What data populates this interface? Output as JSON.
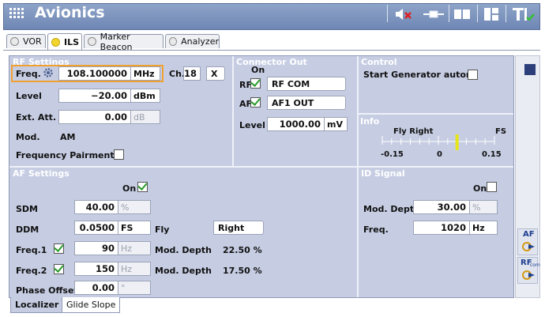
{
  "app": {
    "title": "Avionics"
  },
  "tabs": [
    {
      "label": "VOR",
      "active": false
    },
    {
      "label": "ILS",
      "active": true
    },
    {
      "label": "Marker Beacon",
      "active": false
    },
    {
      "label": "Analyzer",
      "active": false
    }
  ],
  "rf": {
    "title": "RF Settings",
    "freq_label": "Freq.",
    "freq_value": "108.100000",
    "freq_unit": "MHz",
    "ch_label": "Ch.",
    "ch_value": "18",
    "ch_suffix": "X",
    "level_label": "Level",
    "level_value": "−20.00",
    "level_unit": "dBm",
    "ext_label": "Ext. Att.",
    "ext_value": "0.00",
    "ext_unit": "dB",
    "mod_label": "Mod.",
    "mod_value": "AM",
    "pair_label": "Frequency Pairment",
    "pair_checked": false
  },
  "connector": {
    "title": "Connector Out",
    "on_label": "On",
    "rf_label": "RF",
    "rf_checked": true,
    "rf_value": "RF COM",
    "af_label": "AF",
    "af_checked": true,
    "af_value": "AF1 OUT",
    "level_label": "Level",
    "level_value": "1000.00",
    "level_unit": "mV"
  },
  "control": {
    "title": "Control",
    "start_label": "Start Generator autom.",
    "start_checked": false
  },
  "info": {
    "title": "Info",
    "fly_label": "Fly Right",
    "fs_label": "FS",
    "ticks": [
      "-0.15",
      "0",
      "0.15"
    ],
    "indicator_value": 0.05,
    "indicator_color": "#e5e51a"
  },
  "af": {
    "title": "AF Settings",
    "on_label": "On",
    "on_checked": true,
    "sdm_label": "SDM",
    "sdm_value": "40.00",
    "sdm_unit": "%",
    "ddm_label": "DDM",
    "ddm_value": "0.0500",
    "ddm_unit": "FS",
    "fly_label": "Fly",
    "fly_value": "Right",
    "freq1_label": "Freq.1",
    "freq1_checked": true,
    "freq1_value": "90",
    "freq1_unit": "Hz",
    "mod1_label": "Mod. Depth",
    "mod1_value": "22.50",
    "mod1_unit": "%",
    "freq2_label": "Freq.2",
    "freq2_checked": true,
    "freq2_value": "150",
    "freq2_unit": "Hz",
    "mod2_label": "Mod. Depth",
    "mod2_value": "17.50",
    "mod2_unit": "%",
    "phase_label": "Phase Offset",
    "phase_value": "0.00",
    "phase_unit": "°"
  },
  "id": {
    "title": "ID Signal",
    "on_label": "On",
    "on_checked": false,
    "mod_label": "Mod. Depth",
    "mod_value": "30.00",
    "mod_unit": "%",
    "freq_label": "Freq.",
    "freq_value": "1020",
    "freq_unit": "Hz"
  },
  "bottom_tabs": [
    {
      "label": "Localizer",
      "active": true
    },
    {
      "label": "Glide Slope",
      "active": false
    }
  ],
  "right_buttons": {
    "af_label": "AF",
    "rf_label": "RF",
    "rf_sub": "com"
  },
  "colors": {
    "accent_orange": "#f0a030",
    "panel": "#c6cde3",
    "titlebar": "#7b91bc",
    "check": "#2a9c2a"
  }
}
